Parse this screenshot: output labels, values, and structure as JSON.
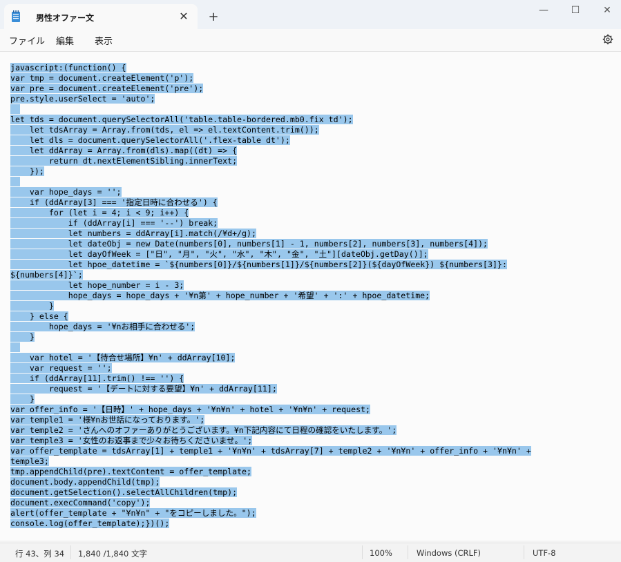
{
  "window": {
    "tab_title": "男性オファー文",
    "tab_close": "✕",
    "new_tab": "+",
    "minimize": "—",
    "maximize": "☐",
    "close": "✕"
  },
  "menu": {
    "items": [
      "ファイル",
      "編集",
      "表示"
    ]
  },
  "editor": {
    "lines": [
      "javascript:(function() {",
      "var tmp = document.createElement('p');",
      "var pre = document.createElement('pre');",
      "pre.style.userSelect = 'auto';",
      "",
      "let tds = document.querySelectorAll('table.table-bordered.mb0.fix td');",
      "    let tdsArray = Array.from(tds, el => el.textContent.trim());",
      "    let dls = document.querySelectorAll('.flex-table dt');",
      "    let ddArray = Array.from(dls).map((dt) => {",
      "        return dt.nextElementSibling.innerText;",
      "    });",
      "",
      "    var hope_days = '';",
      "    if (ddArray[3] === '指定日時に合わせる') {",
      "        for (let i = 4; i < 9; i++) {",
      "            if (ddArray[i] === '--') break;",
      "            let numbers = ddArray[i].match(/¥d+/g);",
      "            let dateObj = new Date(numbers[0], numbers[1] - 1, numbers[2], numbers[3], numbers[4]);",
      "            let dayOfWeek = [\"日\", \"月\", \"火\", \"水\", \"木\", \"金\", \"土\"][dateObj.getDay()];",
      "            let hpoe_datetime = `${numbers[0]}/${numbers[1]}/${numbers[2]}(${dayOfWeek}) ${numbers[3]}:",
      "${numbers[4]}`;",
      "            let hope_number = i - 3;",
      "            hope_days = hope_days + '¥n第' + hope_number + '希望' + ':' + hpoe_datetime;",
      "        }",
      "    } else {",
      "        hope_days = '¥nお相手に合わせる';",
      "    }",
      "",
      "    var hotel = '【待合せ場所】¥n' + ddArray[10];",
      "    var request = '';",
      "    if (ddArray[11].trim() !== '') {",
      "        request = '【デートに対する要望】¥n' + ddArray[11];",
      "    }",
      "var offer_info = '【日時】' + hope_days + '¥n¥n' + hotel + '¥n¥n' + request;",
      "var temple1 = '様¥nお世話になっております。';",
      "var temple2 = 'さんへのオファーありがとうございます。¥n下記内容にて日程の確認をいたします。';",
      "var temple3 = '女性のお返事まで少々お待ちくださいませ。';",
      "var offer_template = tdsArray[1] + temple1 + '¥n¥n' + tdsArray[7] + temple2 + '¥n¥n' + offer_info + '¥n¥n' +",
      "temple3;",
      "tmp.appendChild(pre).textContent = offer_template;",
      "document.body.appendChild(tmp);",
      "document.getSelection().selectAllChildren(tmp);",
      "document.execCommand('copy');",
      "alert(offer_template + \"¥n¥n\" + \"をコピーしました。\");",
      "console.log(offer_template);})();"
    ]
  },
  "status": {
    "position": "行 43、列 34",
    "chars": "1,840 /1,840 文字",
    "zoom": "100%",
    "line_ending": "Windows (CRLF)",
    "encoding": "UTF-8"
  },
  "colors": {
    "selection": "#99c7ec",
    "titlebar": "#eef2f7",
    "editor_bg": "#fbfbfb"
  }
}
